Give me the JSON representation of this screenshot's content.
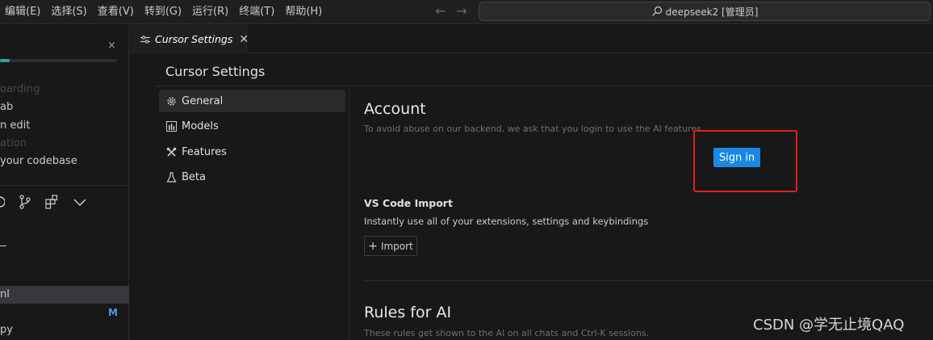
{
  "menu": [
    "编辑(E)",
    "选择(S)",
    "查看(V)",
    "转到(G)",
    "运行(R)",
    "终端(T)",
    "帮助(H)"
  ],
  "command_center": {
    "text": "deepseek2 [管理员]",
    "icon": "search-icon"
  },
  "sidebar": {
    "progress_fraction": 0.08,
    "onboarding_text": "oarding",
    "lines": [
      "ab",
      "n edit",
      "ation",
      "your codebase"
    ],
    "file_rows": [
      "nl",
      "py"
    ],
    "modified_badge": "M",
    "toolbar_icons": [
      "source-control-icon",
      "branch-icon",
      "extensions-icon",
      "chevron-down-icon"
    ]
  },
  "tab": {
    "label": "Cursor Settings",
    "icon": "settings-sliders-icon"
  },
  "settings": {
    "title": "Cursor Settings",
    "nav": [
      {
        "label": "General",
        "icon": "gear-icon",
        "active": true
      },
      {
        "label": "Models",
        "icon": "bar-chart-icon",
        "active": false
      },
      {
        "label": "Features",
        "icon": "tools-icon",
        "active": false
      },
      {
        "label": "Beta",
        "icon": "flask-icon",
        "active": false
      }
    ],
    "account": {
      "title": "Account",
      "description": "To avoid abuse on our backend, we ask that you login to use the AI features.",
      "signin_label": "Sign in"
    },
    "vscode_import": {
      "title": "VS Code Import",
      "description": "Instantly use all of your extensions, settings and keybindings",
      "import_label": "Import"
    },
    "rules": {
      "title": "Rules for AI",
      "description": "These rules get shown to the AI on all chats and Ctrl-K sessions."
    }
  },
  "colors": {
    "accent": "#1a88e2",
    "highlight": "#e0201a"
  },
  "watermark": "CSDN @学无止境QAQ"
}
